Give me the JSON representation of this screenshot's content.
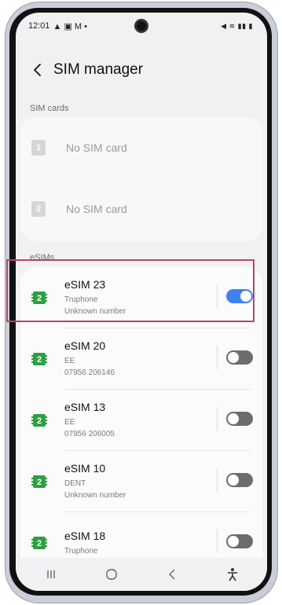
{
  "status_bar": {
    "time": "12:01",
    "left_icons": "▲ ▣ M •",
    "right_icons": "◀ ≋ ▮▮ ▮"
  },
  "header": {
    "back_icon": "chevron-left-icon",
    "title": "SIM manager"
  },
  "sim_cards": {
    "section_label": "SIM cards",
    "items": [
      {
        "slot": "1",
        "label": "No SIM card"
      },
      {
        "slot": "2",
        "label": "No SIM card"
      }
    ]
  },
  "esims": {
    "section_label": "eSIMs",
    "items": [
      {
        "icon": "esim-chip-icon",
        "badge": "2",
        "name": "eSIM 23",
        "carrier": "Truphone",
        "number": "Unknown number",
        "enabled": true
      },
      {
        "icon": "esim-chip-icon",
        "badge": "2",
        "name": "eSIM 20",
        "carrier": "EE",
        "number": "07956 206146",
        "enabled": false
      },
      {
        "icon": "esim-chip-icon",
        "badge": "2",
        "name": "eSIM 13",
        "carrier": "EE",
        "number": "07956 206005",
        "enabled": false
      },
      {
        "icon": "esim-chip-icon",
        "badge": "2",
        "name": "eSIM 10",
        "carrier": "DENT",
        "number": "Unknown number",
        "enabled": false
      },
      {
        "icon": "esim-chip-icon",
        "badge": "2",
        "name": "eSIM 18",
        "carrier": "Truphone",
        "number": "",
        "enabled": false
      }
    ]
  },
  "nav_bar": {
    "recents_icon": "recents-icon",
    "home_icon": "home-icon",
    "back_icon": "back-icon",
    "accessibility_icon": "accessibility-icon"
  },
  "colors": {
    "accent": "#3e82f0",
    "esim_icon": "#2ea043",
    "highlight": "#b04a63"
  }
}
